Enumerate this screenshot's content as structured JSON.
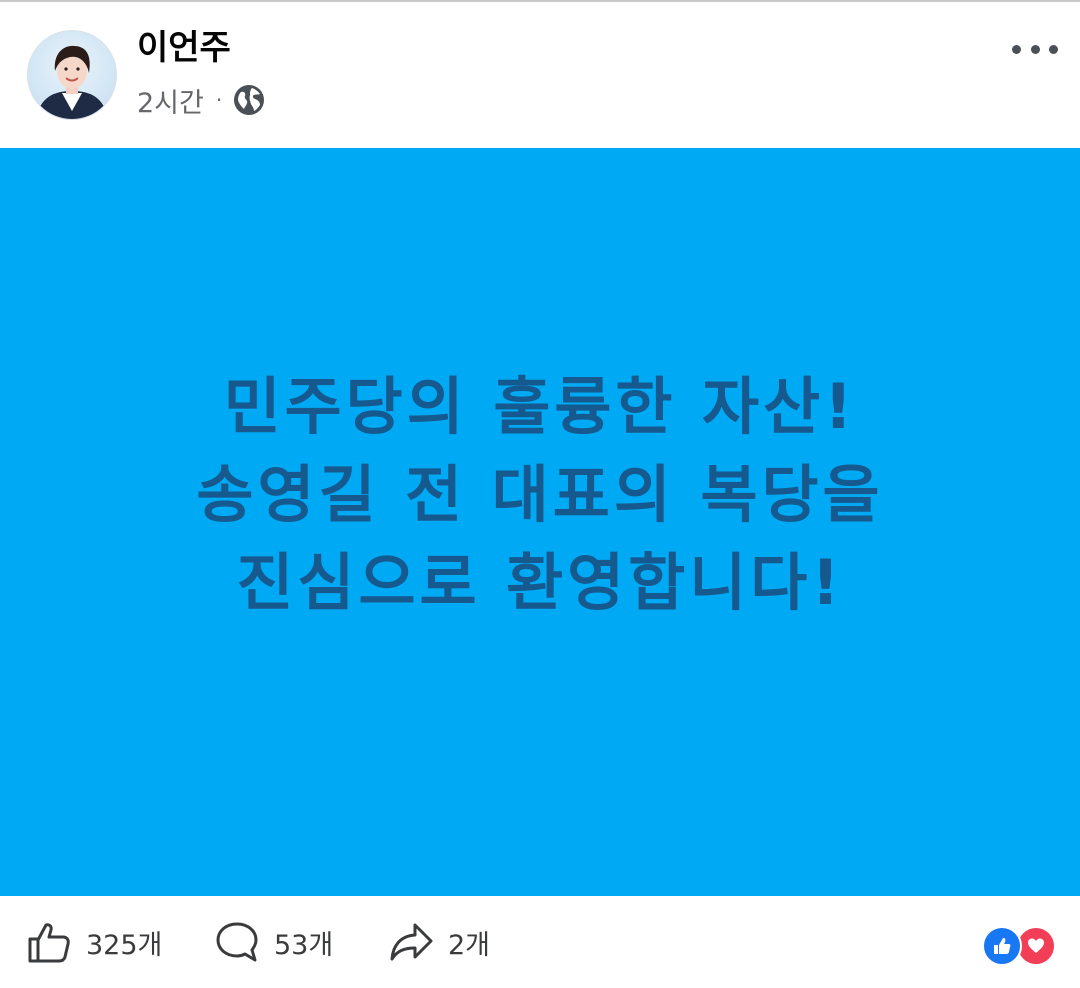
{
  "post": {
    "author": "이언주",
    "time": "2시간",
    "separator": "·",
    "privacy_icon": "globe-icon",
    "menu_icon": "more-horizontal-icon",
    "card": {
      "background_color": "#00a9f4",
      "text_color": "#15598e",
      "lines": [
        "민주당의 훌륭한 자산!",
        "송영길 전 대표의 복당을",
        "진심으로 환영합니다!"
      ]
    }
  },
  "footer": {
    "likes": "325개",
    "comments": "53개",
    "shares": "2개",
    "reactions": [
      "like",
      "love"
    ]
  }
}
